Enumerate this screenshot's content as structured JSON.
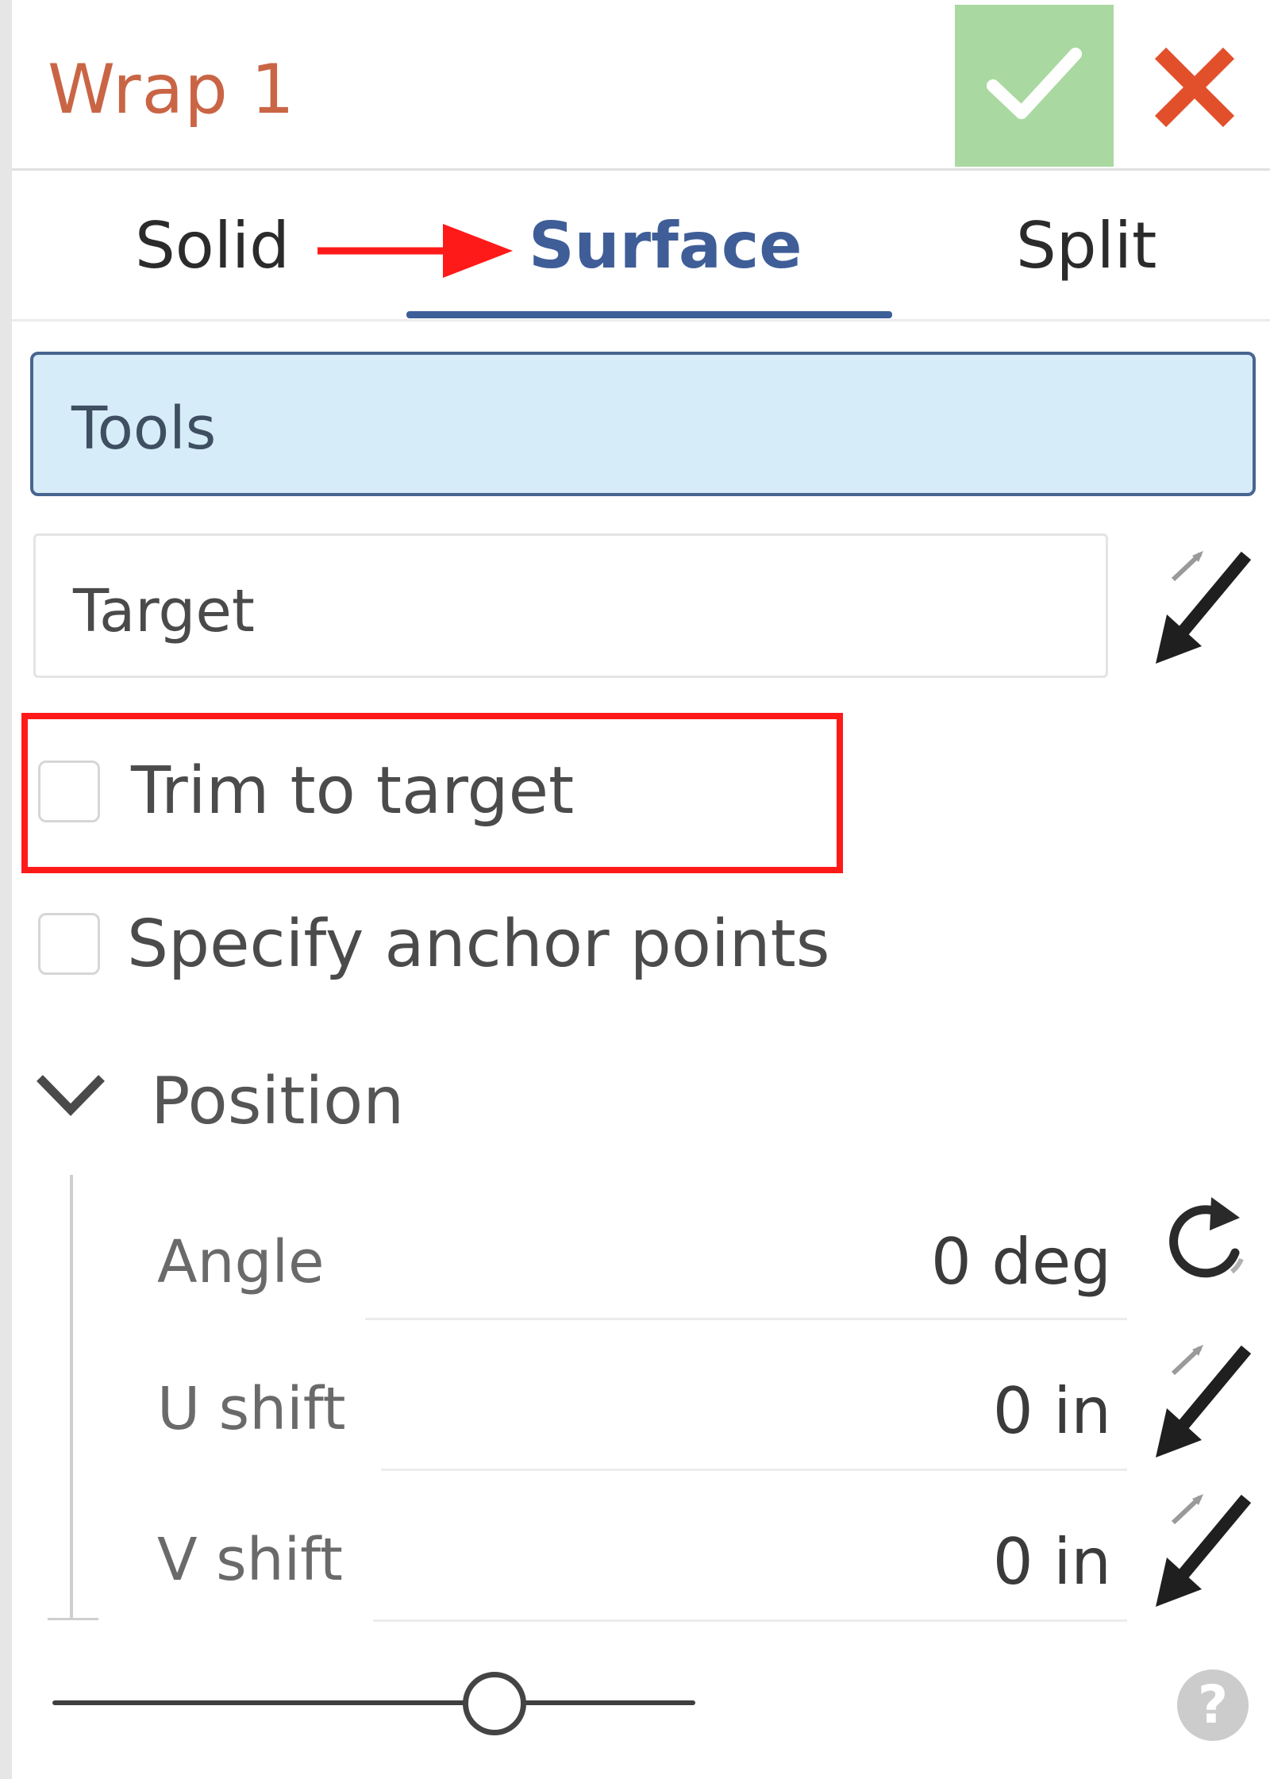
{
  "dialog": {
    "title": "Wrap 1",
    "ok_icon": "checkmark-icon",
    "cancel_icon": "close-icon",
    "colors": {
      "title": "#c96545",
      "ok_bg": "#a9d9a1",
      "cancel": "#e2502b",
      "accent": "#3f5e98",
      "highlight": "#ff1a1a"
    }
  },
  "tabs": {
    "items": [
      {
        "label": "Solid"
      },
      {
        "label": "Surface",
        "selected": true
      },
      {
        "label": "Split"
      }
    ]
  },
  "fields": {
    "tools": {
      "label": "Tools",
      "active": true
    },
    "target": {
      "label": "Target"
    }
  },
  "options": {
    "trim_to_target": {
      "label": "Trim to target",
      "checked": false
    },
    "specify_anchor_points": {
      "label": "Specify anchor points",
      "checked": false
    }
  },
  "position": {
    "title": "Position",
    "expanded": true,
    "rows": [
      {
        "label": "Angle",
        "value": "0 deg",
        "icon": "rotate-icon"
      },
      {
        "label": "U shift",
        "value": "0 in",
        "icon": "flip-direction-icon"
      },
      {
        "label": "V shift",
        "value": "0 in",
        "icon": "flip-direction-icon"
      }
    ]
  },
  "footer": {
    "slider_value_fraction": 0.68,
    "help_label": "?"
  }
}
